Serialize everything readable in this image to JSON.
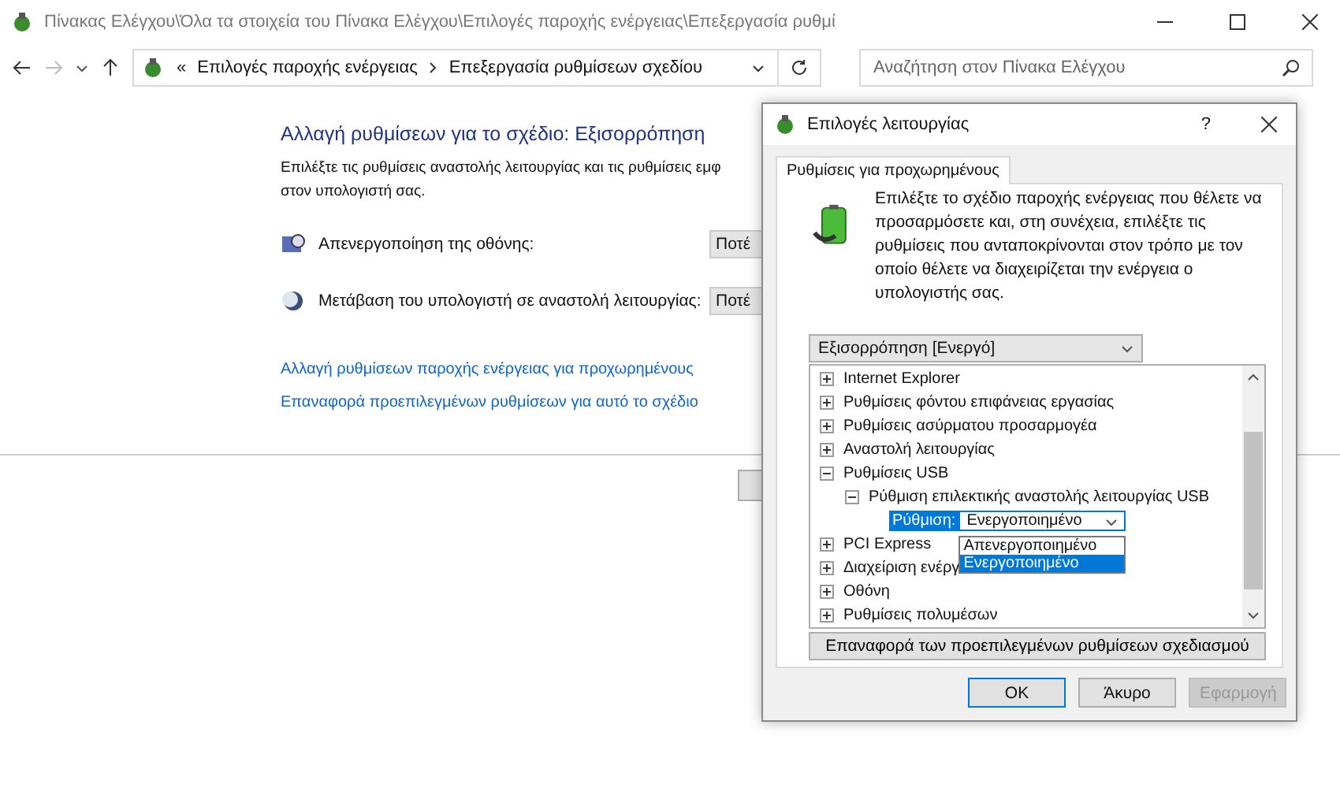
{
  "window": {
    "title": "Πίνακας Ελέγχου\\Όλα τα στοιχεία του Πίνακα Ελέγχου\\Επιλογές παροχής ενέργειας\\Επεξεργασία ρυθμί"
  },
  "address_bar": {
    "overflow": "«",
    "crumbs": [
      "Επιλογές παροχής ενέργειας",
      "Επεξεργασία ρυθμίσεων σχεδίου"
    ]
  },
  "search": {
    "placeholder": "Αναζήτηση στον Πίνακα Ελέγχου"
  },
  "page": {
    "heading": "Αλλαγή ρυθμίσεων για το σχέδιο: Εξισορρόπηση",
    "description": "Επιλέξτε τις ρυθμίσεις αναστολής λειτουργίας και τις ρυθμίσεις εμφ",
    "description_2": "στον υπολογιστή σας.",
    "settings": [
      {
        "kind": "display",
        "label": "Απενεργοποίηση της οθόνης:",
        "value": "Ποτέ"
      },
      {
        "kind": "sleep",
        "label": "Μετάβαση του υπολογιστή σε αναστολή λειτουργίας:",
        "value": "Ποτέ"
      }
    ],
    "links": [
      "Αλλαγή ρυθμίσεων παροχής ενέργειας για προχωρημένους",
      "Επαναφορά προεπιλεγμένων ρυθμίσεων για αυτό το σχέδιο"
    ]
  },
  "dialog": {
    "title": "Επιλογές λειτουργίας",
    "help": "?",
    "tabs": [
      {
        "label": "Ρυθμίσεις για προχωρημένους",
        "selected": true
      }
    ],
    "intro": "Επιλέξτε το σχέδιο παροχής ενέργειας που θέλετε να προσαρμόσετε και, στη συνέχεια, επιλέξτε τις ρυθμίσεις που ανταποκρίνονται στον τρόπο με τον οποίο θέλετε να διαχειρίζεται την ενέργεια ο υπολογιστής σας.",
    "plan": "Εξισορρόπηση [Ενεργό]",
    "tree": [
      {
        "label": "Internet Explorer",
        "expanded": false
      },
      {
        "label": "Ρυθμίσεις φόντου επιφάνειας εργασίας",
        "expanded": false
      },
      {
        "label": "Ρυθμίσεις ασύρματου προσαρμογέα",
        "expanded": false
      },
      {
        "label": "Αναστολή λειτουργίας",
        "expanded": false
      },
      {
        "label": "Ρυθμίσεις USB",
        "expanded": true,
        "children": [
          {
            "label": "Ρύθμιση επιλεκτικής αναστολής λειτουργίας USB",
            "expanded": true,
            "setting": {
              "label": "Ρύθμιση:",
              "value": "Ενεργοποιημένο",
              "options": [
                {
                  "label": "Απενεργοποιημένο",
                  "selected": false
                },
                {
                  "label": "Ενεργοποιημένο",
                  "selected": true
                }
              ]
            }
          }
        ]
      },
      {
        "label": "PCI Express",
        "expanded": false
      },
      {
        "label": "Διαχείριση ενέργ",
        "expanded": false
      },
      {
        "label": "Οθόνη",
        "expanded": false
      },
      {
        "label": "Ρυθμίσεις πολυμέσων",
        "expanded": false
      }
    ],
    "restore_button": "Επαναφορά των προεπιλεγμένων ρυθμίσεων σχεδιασμού",
    "buttons": [
      {
        "label": "OK",
        "disabled": false,
        "default": true
      },
      {
        "label": "Άκυρο",
        "disabled": false,
        "default": false
      },
      {
        "label": "Εφαρμογή",
        "disabled": true,
        "default": false
      }
    ]
  }
}
